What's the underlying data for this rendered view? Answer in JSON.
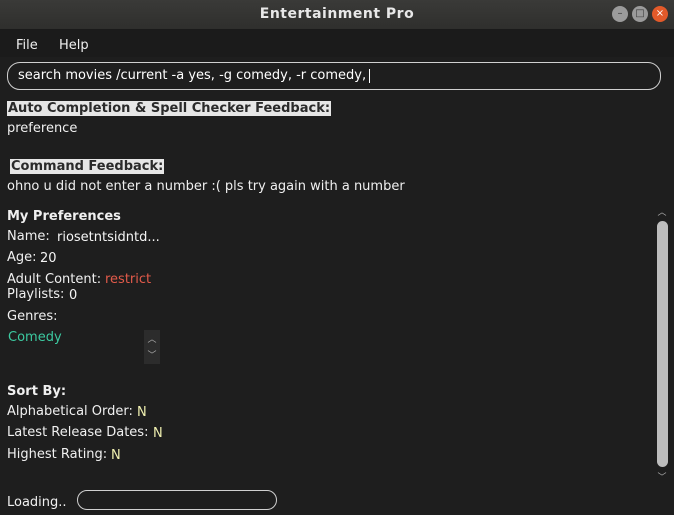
{
  "window": {
    "title": "Entertainment Pro"
  },
  "menu": {
    "items": [
      "File",
      "Help"
    ]
  },
  "command_input": {
    "value": "search movies /current -a yes, -g comedy, -r comedy,"
  },
  "autocomplete": {
    "heading": "Auto Completion & Spell Checker Feedback:",
    "text": "preference"
  },
  "command_feedback": {
    "heading": "Command Feedback:",
    "text": "ohno u did not enter a number :( pls try again with a number"
  },
  "preferences": {
    "heading": "My Preferences",
    "name_label": "Name:",
    "name_value": "riosetntsidntd...",
    "age_label": "Age:",
    "age_value": "20",
    "adult_label": "Adult Content:",
    "adult_value": "restrict",
    "playlists_label": "Playlists:",
    "playlists_value": "0",
    "genres_label": "Genres:",
    "genres": [
      "Comedy"
    ]
  },
  "sort": {
    "heading": "Sort By:",
    "alpha_label": "Alphabetical Order:",
    "alpha_value": "N",
    "latest_label": "Latest Release Dates:",
    "latest_value": "N",
    "rating_label": "Highest Rating:",
    "rating_value": "N"
  },
  "status": {
    "loading_label": "Loading.."
  },
  "icons": {
    "minimize": "minimize-icon",
    "maximize": "maximize-icon",
    "close": "close-icon",
    "scroll_up": "chevron-up-icon",
    "scroll_down": "chevron-down-icon"
  },
  "colors": {
    "background": "#1e1e1e",
    "restrict": "#e25a4a",
    "genre": "#3cc9a0",
    "close_button": "#e25a2a"
  }
}
